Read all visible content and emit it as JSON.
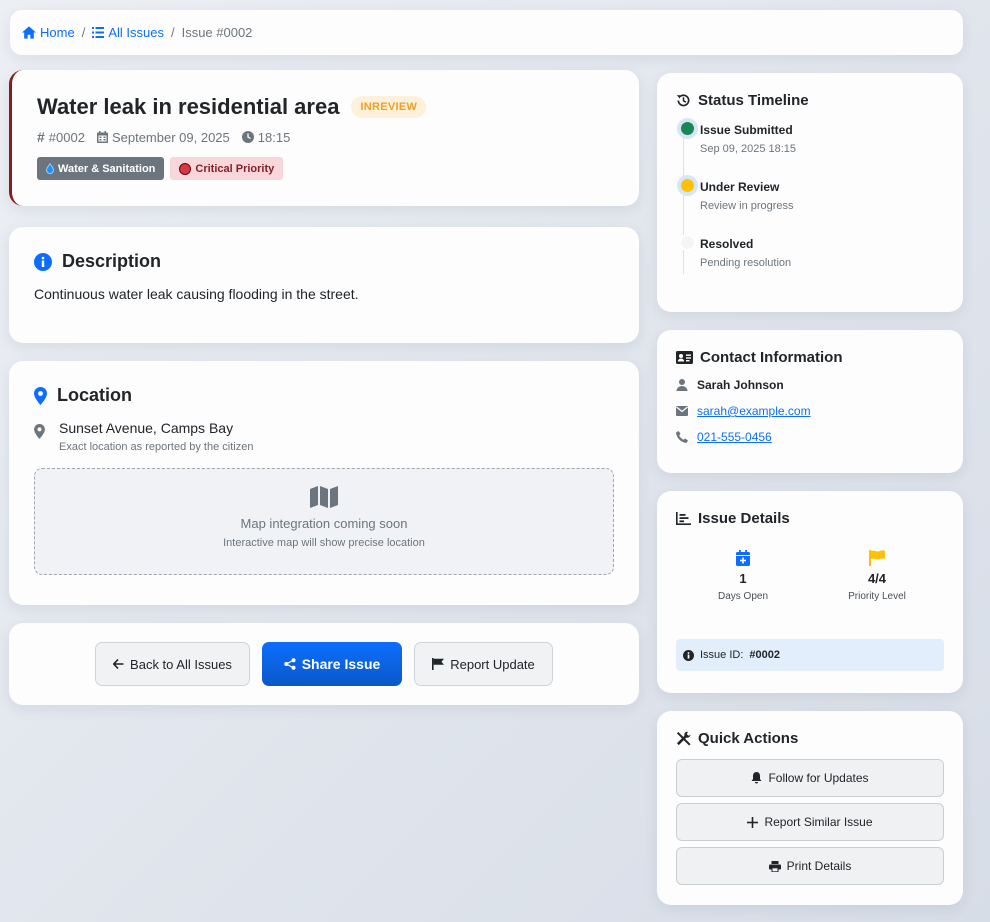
{
  "breadcrumb": {
    "home": "Home",
    "all_issues": "All Issues",
    "separator": "/",
    "current": "Issue #0002"
  },
  "issue": {
    "title": "Water leak in residential area",
    "status": "INREVIEW",
    "number": "#0002",
    "date": "September 09, 2025",
    "time": "18:15",
    "category": "Water & Sanitation",
    "priority": "Critical Priority"
  },
  "description": {
    "title": "Description",
    "text": "Continuous water leak causing flooding in the street."
  },
  "location": {
    "title": "Location",
    "address": "Sunset Avenue, Camps Bay",
    "note": "Exact location as reported by the citizen",
    "map_text": "Map integration coming soon",
    "map_sub": "Interactive map will show precise location"
  },
  "actions": {
    "back": "Back to All Issues",
    "share": "Share Issue",
    "report": "Report Update"
  },
  "timeline": {
    "title": "Status Timeline",
    "items": [
      {
        "title": "Issue Submitted",
        "sub": "Sep 09, 2025 18:15",
        "state": "done"
      },
      {
        "title": "Under Review",
        "sub": "Review in progress",
        "state": "active"
      },
      {
        "title": "Resolved",
        "sub": "Pending resolution",
        "state": "pending"
      }
    ]
  },
  "contact": {
    "title": "Contact Information",
    "name": "Sarah Johnson",
    "email": "sarah@example.com",
    "phone": "021-555-0456"
  },
  "details": {
    "title": "Issue Details",
    "days_open_value": "1",
    "days_open_label": "Days Open",
    "priority_value": "4/4",
    "priority_label": "Priority Level",
    "issue_id_label": "Issue ID:",
    "issue_id_value": "#0002"
  },
  "quick_actions": {
    "title": "Quick Actions",
    "follow": "Follow for Updates",
    "similar": "Report Similar Issue",
    "print": "Print Details"
  },
  "colors": {
    "primary": "#0d6efd",
    "warning": "#ffc107",
    "success": "#198754",
    "danger": "#dc3545",
    "accent_border": "#8b1a1a"
  }
}
